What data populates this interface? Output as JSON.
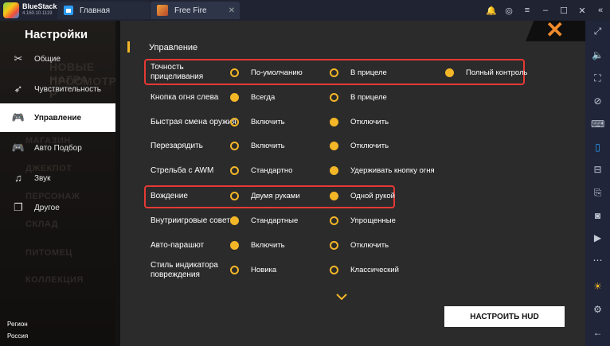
{
  "window": {
    "app_name": "BlueStacks",
    "app_version": "4.160.10.1119",
    "tabs": [
      {
        "label": "Главная"
      },
      {
        "label": "Free Fire"
      }
    ]
  },
  "sidebar": {
    "title": "Настройки",
    "items": [
      {
        "label": "Общие",
        "icon": "tools-icon"
      },
      {
        "label": "Чувствительность",
        "icon": "pointer-icon"
      },
      {
        "label": "Управление",
        "icon": "gamepad-icon",
        "active": true
      },
      {
        "label": "Авто Подбор",
        "icon": "gamepad-icon"
      },
      {
        "label": "Звук",
        "icon": "music-note-icon"
      },
      {
        "label": "Другое",
        "icon": "pages-icon"
      }
    ],
    "background_labels": [
      "НОВЫЕ НАГРА",
      "ПРОСМОТР Р",
      "МАГАЗИН",
      "ДЖЕКПОТ",
      "ПЕРСОНАЖ",
      "СКЛАД",
      "ПИТОМЕЦ",
      "КОЛЛЕКЦИЯ"
    ],
    "region_label": "Регион",
    "region_value": "Россия"
  },
  "main": {
    "section_title": "Управление",
    "rows": [
      {
        "label": "Точность прицеливания",
        "options": [
          "По-умолчанию",
          "В прицеле",
          "Полный контроль"
        ],
        "selected": 2,
        "highlighted": true
      },
      {
        "label": "Кнопка огня слева",
        "options": [
          "Всегда",
          "В прицеле"
        ],
        "selected": 0
      },
      {
        "label": "Быстрая смена оружия",
        "options": [
          "Включить",
          "Отключить"
        ],
        "selected": 1
      },
      {
        "label": "Перезарядить",
        "options": [
          "Включить",
          "Отключить"
        ],
        "selected": 1
      },
      {
        "label": "Стрельба с AWM",
        "options": [
          "Стандартно",
          "Удерживать кнопку огня"
        ],
        "selected": 1
      },
      {
        "label": "Вождение",
        "options": [
          "Двумя руками",
          "Одной рукой"
        ],
        "selected": 1,
        "highlighted": true
      },
      {
        "label": "Внутриигровые советы",
        "options": [
          "Стандартные",
          "Упрощенные"
        ],
        "selected": 0
      },
      {
        "label": "Авто-парашют",
        "options": [
          "Включить",
          "Отключить"
        ],
        "selected": 0
      },
      {
        "label": "Стиль индикатора повреждения",
        "options": [
          "Новика",
          "Классический"
        ],
        "selected": 0
      }
    ],
    "hud_button": "НАСТРОИТЬ HUD"
  },
  "colors": {
    "accent": "#f3b627",
    "highlight": "#e53935",
    "close": "#f08a2c"
  }
}
